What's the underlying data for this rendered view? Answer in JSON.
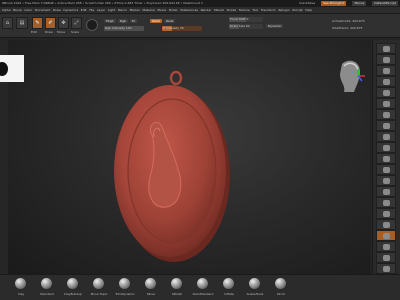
{
  "titlebar": {
    "stats": "ZBrush 2022 • Free Mem 7.098GB • Active Mem 958 • Scratch Disk 260 • ZTime 0.483 Timer • PolyCount 409,644 KP • MeshCount 1",
    "quicksave": "QuickSave",
    "see_through": "See-through 0",
    "menus": "Menus",
    "default_zscript": "DefaultZScript"
  },
  "menubar": {
    "items": [
      "Alpha",
      "Brush",
      "Color",
      "Document",
      "Draw",
      "Dynamics",
      "Edit",
      "File",
      "Layer",
      "Light",
      "Macro",
      "Marker",
      "Material",
      "Movie",
      "Picker",
      "Preferences",
      "Render",
      "Stencil",
      "Stroke",
      "Texture",
      "Tool",
      "Transform",
      "Zplugin",
      "Zscript",
      "Help"
    ]
  },
  "toolbar": {
    "home_label": "Home",
    "lightbox_label": "LightBox",
    "edit_label": "Edit",
    "draw_label": "Draw",
    "move_label": "Move",
    "scale_label": "Scale",
    "rotate_label": "Rotate",
    "mrgb_label": "Mrgb",
    "rgb_label": "Rgb",
    "m_label": "M",
    "zadd_label": "Zadd",
    "zsub_label": "Zsub",
    "focal_shift": "Focal Shift 0",
    "draw_size": "Draw Size 64",
    "dynamic_label": "Dynamic",
    "z_intensity": "Z Intensity 25",
    "rgb_intensity": "Rgb Intensity 100",
    "active_points": "ActivePoints: 409,875",
    "total_points": "TotalPoints: 409,875"
  },
  "brushes": [
    {
      "name": "Clay"
    },
    {
      "name": "Standard"
    },
    {
      "name": "ClayBuildup"
    },
    {
      "name": "Move Topol"
    },
    {
      "name": "TrimDynamic"
    },
    {
      "name": "Move"
    },
    {
      "name": "hPolish"
    },
    {
      "name": "DamStandard"
    },
    {
      "name": "Inflate"
    },
    {
      "name": "SnakeHook"
    },
    {
      "name": "Pinch"
    }
  ],
  "colors": {
    "accent": "#a65e24",
    "medal": "#a9483a",
    "background": "#242424"
  }
}
